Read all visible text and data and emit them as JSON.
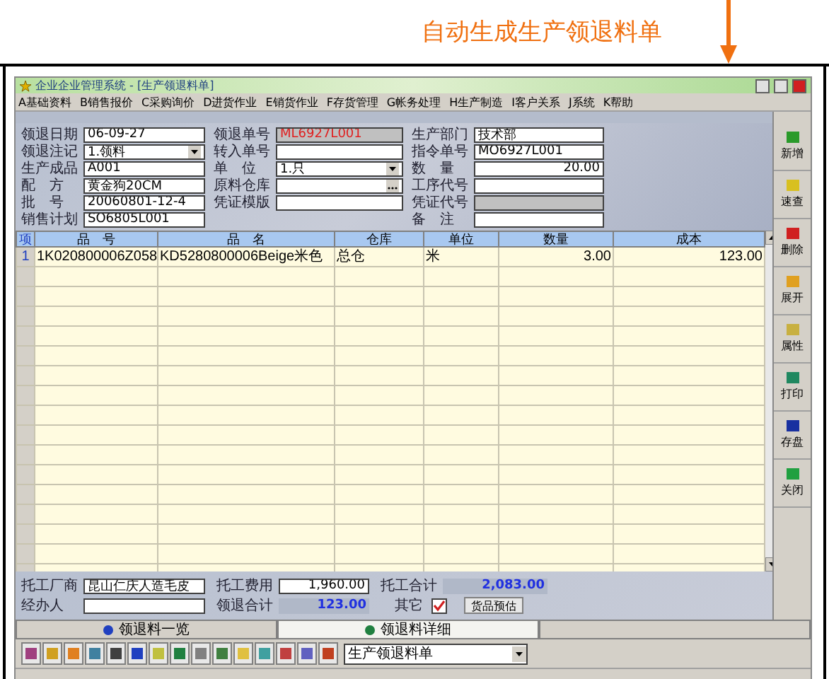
{
  "annotation": {
    "text": "自动生成生产领退料单"
  },
  "window": {
    "title": "企业企业管理系统 - [生产领退料单]",
    "menu": [
      "A基础资料",
      "B销售报价",
      "C采购询价",
      "D进货作业",
      "E销货作业",
      "F存货管理",
      "G帐务处理",
      "H生产制造",
      "I客户关系",
      "J系统",
      "K帮助"
    ]
  },
  "form": {
    "columns": [
      [
        {
          "label": "领退日期",
          "value": "06-09-27",
          "kind": "text"
        },
        {
          "label": "领退注记",
          "value": "1.领料",
          "kind": "dropdown"
        },
        {
          "label": "生产成品",
          "value": "A001",
          "kind": "text"
        },
        {
          "label": "配　方",
          "value": "黄金狗20CM",
          "kind": "text"
        },
        {
          "label": "批　号",
          "value": "20060801-12-4",
          "kind": "text"
        },
        {
          "label": "销售计划",
          "value": "SO6805L001",
          "kind": "text"
        }
      ],
      [
        {
          "label": "领退单号",
          "value": "ML6927L001",
          "kind": "locked"
        },
        {
          "label": "转入单号",
          "kind": "text"
        },
        {
          "label": "单　位",
          "value": "1.只",
          "kind": "dropdown"
        },
        {
          "label": "原料仓库",
          "kind": "lookup"
        },
        {
          "label": "凭证模版",
          "kind": "text"
        }
      ],
      [
        {
          "label": "生产部门",
          "value": "技术部",
          "kind": "text"
        },
        {
          "label": "指令单号",
          "value": "MO6927L001",
          "kind": "text"
        },
        {
          "label": "数　量",
          "value": "20.00",
          "kind": "number"
        },
        {
          "label": "工序代号",
          "kind": "text"
        },
        {
          "label": "凭证代号",
          "kind": "locked"
        },
        {
          "label": "备　注",
          "kind": "text"
        }
      ]
    ]
  },
  "side_buttons": [
    "新增",
    "速查",
    "删除",
    "展开",
    "属性",
    "打印",
    "存盘",
    "关闭"
  ],
  "table": {
    "columns": [
      "项",
      "品　号",
      "品　名",
      "仓库",
      "单位",
      "数量",
      "成本"
    ],
    "rows": [
      [
        "1",
        "1K020800006Z058",
        "KD5280800006Beige米色",
        "总仓",
        "米",
        "3.00",
        "123.00"
      ]
    ]
  },
  "footer": {
    "vendor": {
      "label": "托工厂商",
      "value": "昆山仁庆人造毛皮"
    },
    "handler": {
      "label": "经办人"
    },
    "fee": {
      "label": "托工费用",
      "value": "1,960.00"
    },
    "total": {
      "label": "领退合计",
      "value": "123.00"
    },
    "grand": {
      "label": "托工合计",
      "value": "2,083.00"
    },
    "other": {
      "label": "其它",
      "checked": true
    },
    "estimate_button": "货品预估"
  },
  "tabs": [
    {
      "label": "领退料一览",
      "selected": false
    },
    {
      "label": "领退料详细",
      "selected": true
    }
  ],
  "toolbar": {
    "combo": "生产领退料单"
  }
}
